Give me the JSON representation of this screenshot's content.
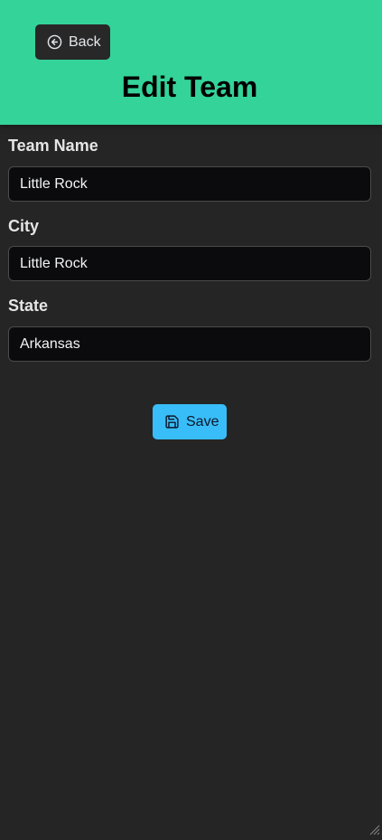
{
  "header": {
    "back_label": "Back",
    "title": "Edit Team",
    "background": "#34d399"
  },
  "form": {
    "team_name": {
      "label": "Team Name",
      "value": "Little Rock"
    },
    "city": {
      "label": "City",
      "value": "Little Rock"
    },
    "state": {
      "label": "State",
      "value": "Arkansas"
    }
  },
  "actions": {
    "save_label": "Save",
    "save_color": "#38bdf8"
  },
  "icons": {
    "back": "circle-arrow-left-icon",
    "save": "floppy-disk-icon"
  }
}
